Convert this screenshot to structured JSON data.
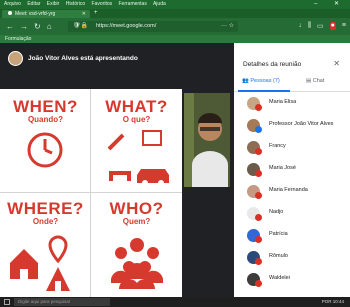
{
  "browser": {
    "menu": [
      "Arquivo",
      "Editar",
      "Exibir",
      "Histórico",
      "Favoritos",
      "Ferramentas",
      "Ajuda"
    ],
    "tab_title": "Meet: vsd-vrfd-yrg",
    "url": "https://meet.google.com/",
    "bookmark": "Formulação"
  },
  "meet": {
    "presenter_label": "João Vitor Alves está apresentando"
  },
  "slide": {
    "quadrants": [
      {
        "title": "WHEN?",
        "subtitle": "Quando?"
      },
      {
        "title": "WHAT?",
        "subtitle": "O que?"
      },
      {
        "title": "WHERE?",
        "subtitle": "Onde?"
      },
      {
        "title": "WHO?",
        "subtitle": "Quem?"
      }
    ],
    "accent": "#d63a2e"
  },
  "panel": {
    "title": "Detalhes da reunião",
    "tabs": {
      "people": "Pessoas (7)",
      "chat": "Chat"
    },
    "participants": [
      {
        "name": "Maria Elisa"
      },
      {
        "name": "Professor João Vitor Alves"
      },
      {
        "name": "Francy"
      },
      {
        "name": "Maria José"
      },
      {
        "name": "Maria Fernanda"
      },
      {
        "name": "Nadjo"
      },
      {
        "name": "Patrícia"
      },
      {
        "name": "Rômulo"
      },
      {
        "name": "Waldelei"
      }
    ]
  },
  "taskbar": {
    "search_placeholder": "Digite aqui para pesquisar",
    "lang": "POR",
    "time": "10:44"
  }
}
